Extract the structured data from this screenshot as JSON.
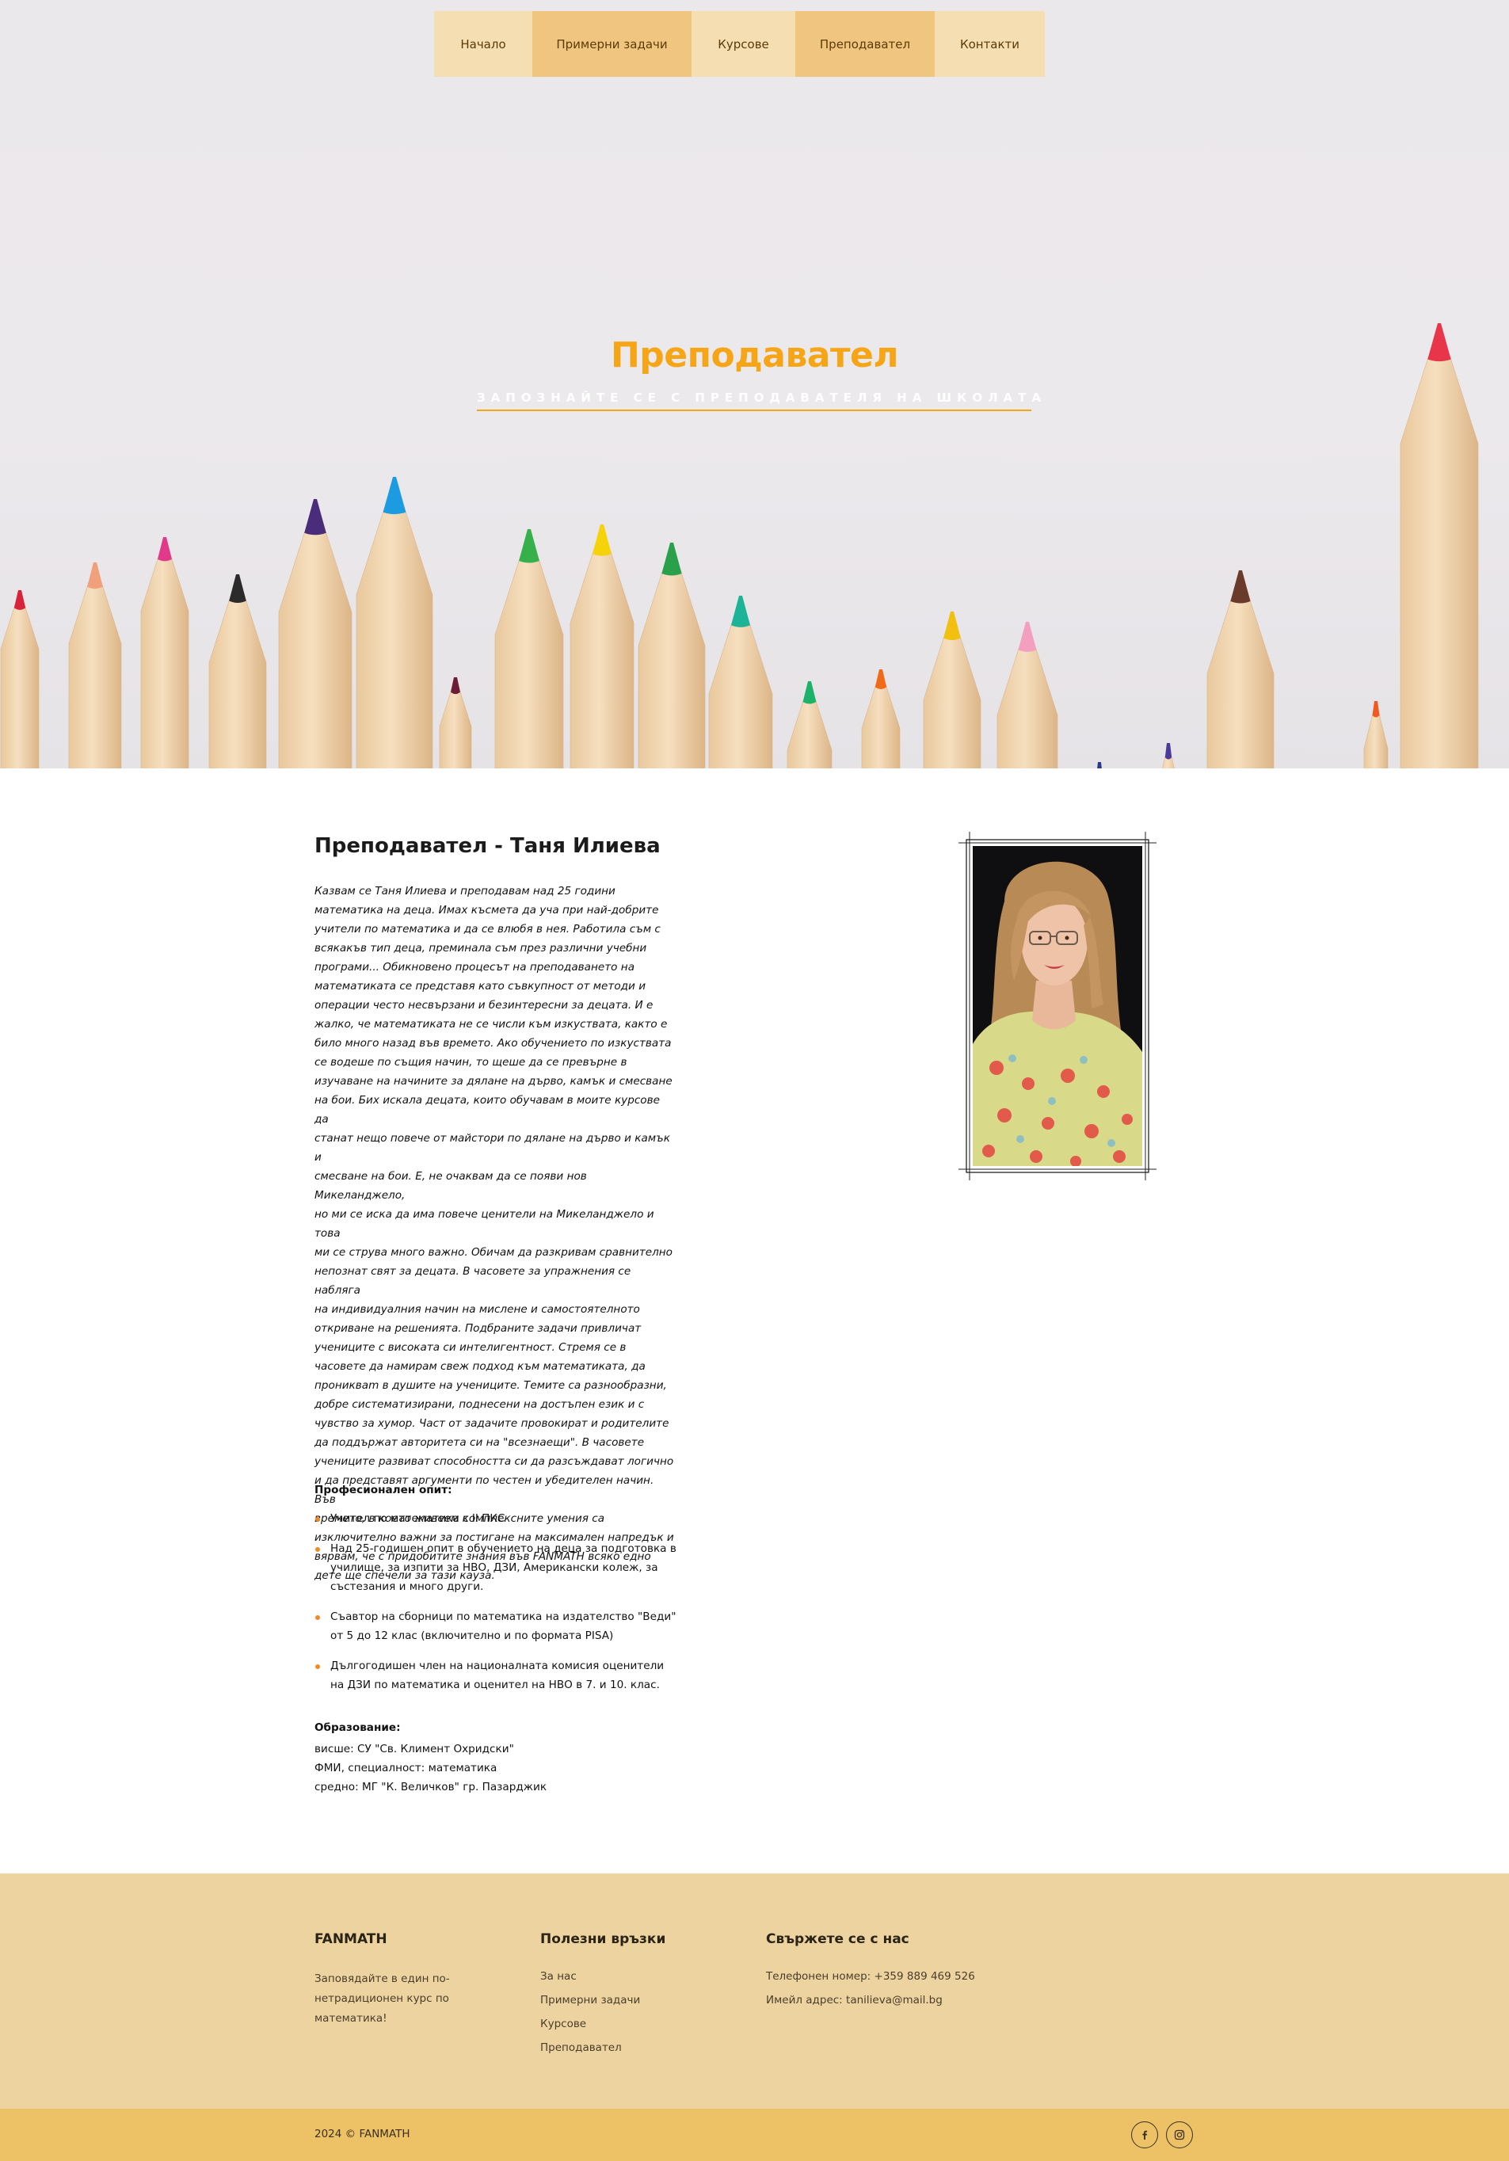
{
  "nav": {
    "items": [
      {
        "label": "Начало"
      },
      {
        "label": "Примерни задачи"
      },
      {
        "label": "Курсове"
      },
      {
        "label": "Преподавател"
      },
      {
        "label": "Контакти"
      }
    ]
  },
  "hero": {
    "title": "Преподавател",
    "subtitle": "ЗАПОЗНАЙТЕ СЕ С ПРЕПОДАВАТЕЛЯ НА ШКОЛАТА"
  },
  "teacher": {
    "name": "Преподавател - Таня Илиева",
    "bio_lines": [
      "Казвам се Таня Илиева и преподавам над 25 години",
      "математика на деца. Имах късмета да уча при най-добрите",
      "учители по математика и да се влюбя в нея. Работила съм с",
      "всякакъв тип деца, преминала съм през различни учебни",
      "програми... Обикновено процесът на преподаването на",
      "математиката се представя като съвкупност от методи и",
      "операции често несвързани и безинтересни за децата. И е",
      "жалко, че математиката не се числи към изкуствата, както е",
      "било много назад във времето. Ако обучението по изкуствата",
      "се водеше по същия начин, то щеше да се превърне в",
      "изучаване на начините за дялане на дърво, камък и смесване",
      "на бои. Бих искала децата, които обучавам в моите курсове да",
      "станат нещо повече от майстори по дялане на дърво и камък и",
      "смесване на бои. Е, не очаквам да се появи нов Микеланджело,",
      "но ми се иска да има повече ценители на Микеланджело и това",
      "ми се струва много важно. Обичам да разкривам сравнително",
      "непознат свят за децата. В часовете за упражнения се набляга",
      "на индивидуалния начин на мислене и самостоятелното",
      "откриване на решенията. Подбраните задачи привличат",
      "учениците с високата си интелигентност. Стремя се в",
      "часовете да намирам свеж подход към математиката, да",
      "проникваm в душите на учениците. Темите са разнообразни,",
      "добре систематизирани, поднесени на достъпен език и с",
      "чувство за хумор. Част от задачите провокират и родителите",
      "да поддържат авторитета си на \"всезнаещи\". В часовете",
      "учениците развиват способността си да разсъждават логично",
      "и да представят аргументи по честен и убедителен начин. Във",
      "времето, в което живеем комплексните умения са",
      "изключително важни за постигане на максимален напредък и",
      "вярвам, че с придобитите знания във FANMATH всяко едно",
      "дете ще спечели за тази кауза."
    ],
    "experience_heading": "Професионален опит:",
    "experience": [
      "Учител по математика с II ПКС",
      "Над 25-годишен опит в обучението на деца за подготовка в училище, за изпити за НВО, ДЗИ, Американски колеж, за състезания и много други.",
      "Съавтор на сборници по математика на издателство \"Веди\" от 5 до 12 клас (включително и по формата PISA)",
      "Дългогодишен член на националната комисия оценители на ДЗИ по математика и оценител на НВО в 7. и 10. клас."
    ],
    "education_heading": "Образование:",
    "education": [
      "висше: СУ \"Св. Климент Охридски\"",
      "ФМИ, специалност: математика",
      "средно: МГ \"К. Величков\" гр. Пазарджик"
    ]
  },
  "footer": {
    "brand": {
      "title": "FANMATH",
      "text_lines": [
        "Заповядайте в един по-",
        "нетрадиционен курс по",
        "математика!"
      ]
    },
    "links": {
      "title": "Полезни връзки",
      "items": [
        "За нас",
        "Примерни задачи",
        "Курсове",
        "Преподавател"
      ]
    },
    "contact": {
      "title": "Свържете се с нас",
      "phone": "Телефонен номер: +359 889 469 526",
      "email": "Имейл адрес: tanilieva@mail.bg"
    },
    "copyright": "2024 © FANMATH",
    "social": [
      {
        "icon": "facebook-icon"
      },
      {
        "icon": "instagram-icon"
      }
    ]
  },
  "colors": {
    "accent": "#f5a515",
    "nav_light": "#f6deb3",
    "nav_dark": "#efc57f",
    "footer_bg": "#ecd3a0",
    "bottom_bar": "#edc166",
    "bullet": "#f08a24"
  }
}
